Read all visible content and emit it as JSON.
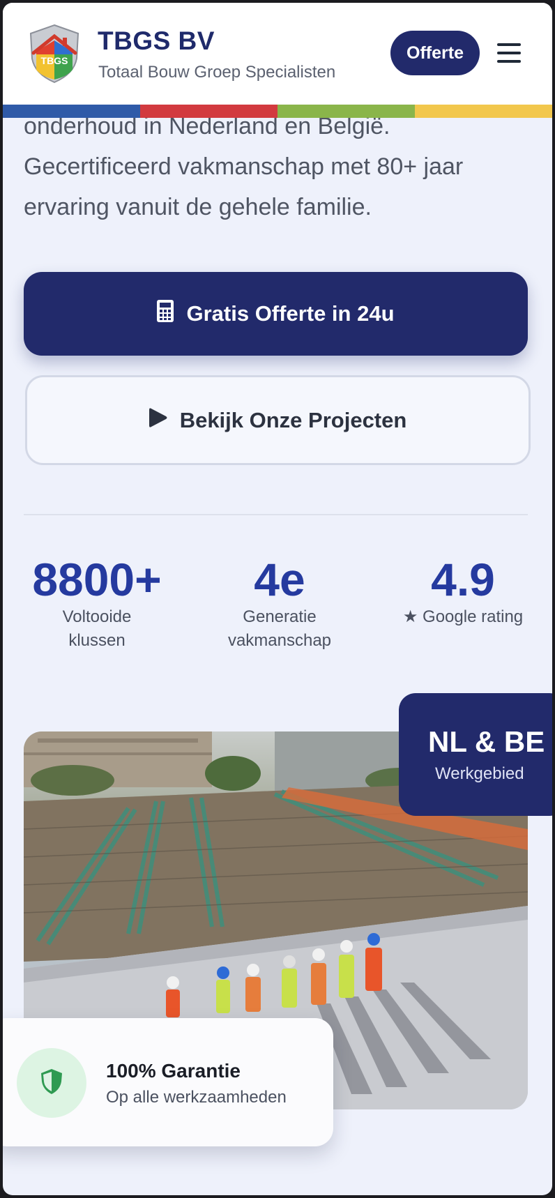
{
  "header": {
    "brand_name": "TBGS BV",
    "brand_subtitle": "Totaal Bouw Groep Specialisten",
    "logo_text": "TBGS",
    "offerte_label": "Offerte",
    "menu_icon": "hamburger-icon"
  },
  "stripe_colors": [
    "#2f5aa8",
    "#d23a3f",
    "#8ab54a",
    "#f2c74c"
  ],
  "hero": {
    "line1": "onderhoud in Nederland en België.",
    "line2": "Gecertificeerd vakmanschap met 80+ jaar",
    "line3": "ervaring vanuit de gehele familie."
  },
  "buttons": {
    "primary_label": "Gratis Offerte in 24u",
    "primary_icon": "calculator-icon",
    "secondary_label": "Bekijk Onze Projecten",
    "secondary_icon": "play-icon"
  },
  "stats": [
    {
      "value": "8800+",
      "label_line1": "Voltooide",
      "label_line2": "klussen"
    },
    {
      "value": "4e",
      "label_line1": "Generatie",
      "label_line2": "vakmanschap"
    },
    {
      "value": "4.9",
      "label_line1": "★ Google rating",
      "label_line2": ""
    }
  ],
  "region_badge": {
    "title": "NL & BE",
    "subtitle": "Werkgebied"
  },
  "guarantee": {
    "title": "100% Garantie",
    "subtitle": "Op alle werkzaamheden",
    "icon": "shield-icon"
  },
  "colors": {
    "brand_navy": "#222a6b",
    "stat_blue": "#253a9f",
    "background": "#eef1fb"
  }
}
